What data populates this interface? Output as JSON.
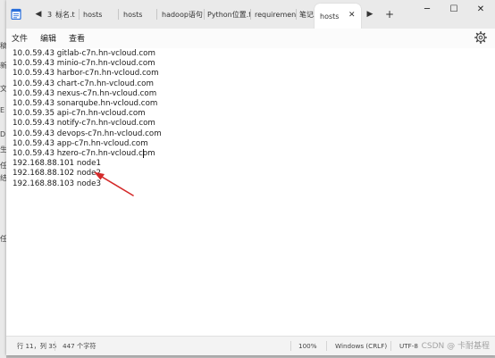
{
  "background_fragments": [
    "稿",
    "新",
    "文",
    "E",
    "D",
    "生",
    "任",
    "结",
    "任"
  ],
  "tabs": [
    {
      "label": "3",
      "name": "tab-3"
    },
    {
      "label": "标名.t",
      "name": "tab-unnamed"
    },
    {
      "label": "hosts",
      "name": "tab-hosts-1"
    },
    {
      "label": "hosts",
      "name": "tab-hosts-2"
    },
    {
      "label": "hadoop语句",
      "name": "tab-hadoop"
    },
    {
      "label": "Python位置.t",
      "name": "tab-python"
    },
    {
      "label": "requirement",
      "name": "tab-requirement"
    },
    {
      "label": "笔记.t",
      "name": "tab-notes"
    }
  ],
  "active_tab": {
    "label": "hosts"
  },
  "menu": {
    "file": "文件",
    "edit": "编辑",
    "view": "查看"
  },
  "lines": [
    "10.0.59.43 gitlab-c7n.hn-vcloud.com",
    "10.0.59.43 minio-c7n.hn-vcloud.com",
    "10.0.59.43 harbor-c7n.hn-vcloud.com",
    "10.0.59.43 chart-c7n.hn-vcloud.com",
    "10.0.59.43 nexus-c7n.hn-vcloud.com",
    "10.0.59.43 sonarqube.hn-vcloud.com",
    "10.0.59.35 api-c7n.hn-vcloud.com",
    "10.0.59.43 notify-c7n.hn-vcloud.com",
    "10.0.59.43 devops-c7n.hn-vcloud.com",
    "10.0.59.43 app-c7n.hn-vcloud.com",
    "10.0.59.43 hzero-c7n.hn-vcloud.com",
    "192.168.88.101 node1",
    "192.168.88.102 node2",
    "192.168.88.103 node3"
  ],
  "status": {
    "position": "行 11，列 35",
    "chars": "447 个字符",
    "zoom": "100%",
    "eol": "Windows (CRLF)",
    "encoding": "UTF-8"
  },
  "watermark": "CSDN @ 卡耐基程",
  "colors": {
    "arrow": "#d42a2a",
    "accent": "#2a6fdb"
  }
}
